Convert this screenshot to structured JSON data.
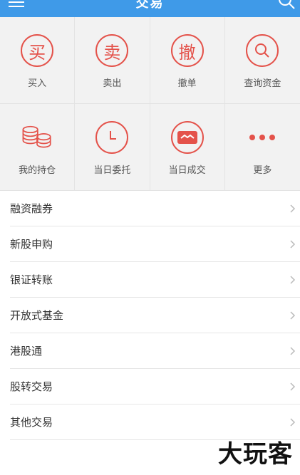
{
  "header": {
    "title": "交易"
  },
  "grid": {
    "items": [
      {
        "label": "买入",
        "glyph": "买"
      },
      {
        "label": "卖出",
        "glyph": "卖"
      },
      {
        "label": "撤单",
        "glyph": "撤"
      },
      {
        "label": "查询资金"
      },
      {
        "label": "我的持仓"
      },
      {
        "label": "当日委托"
      },
      {
        "label": "当日成交"
      },
      {
        "label": "更多"
      }
    ]
  },
  "list": {
    "items": [
      {
        "label": "融资融券"
      },
      {
        "label": "新股申购"
      },
      {
        "label": "银证转账"
      },
      {
        "label": "开放式基金"
      },
      {
        "label": "港股通"
      },
      {
        "label": "股转交易"
      },
      {
        "label": "其他交易"
      }
    ]
  },
  "watermark": {
    "text": "大玩客"
  },
  "colors": {
    "header": "#3f9ae8",
    "accent": "#e4524a",
    "grid_bg": "#f2f2f2"
  }
}
